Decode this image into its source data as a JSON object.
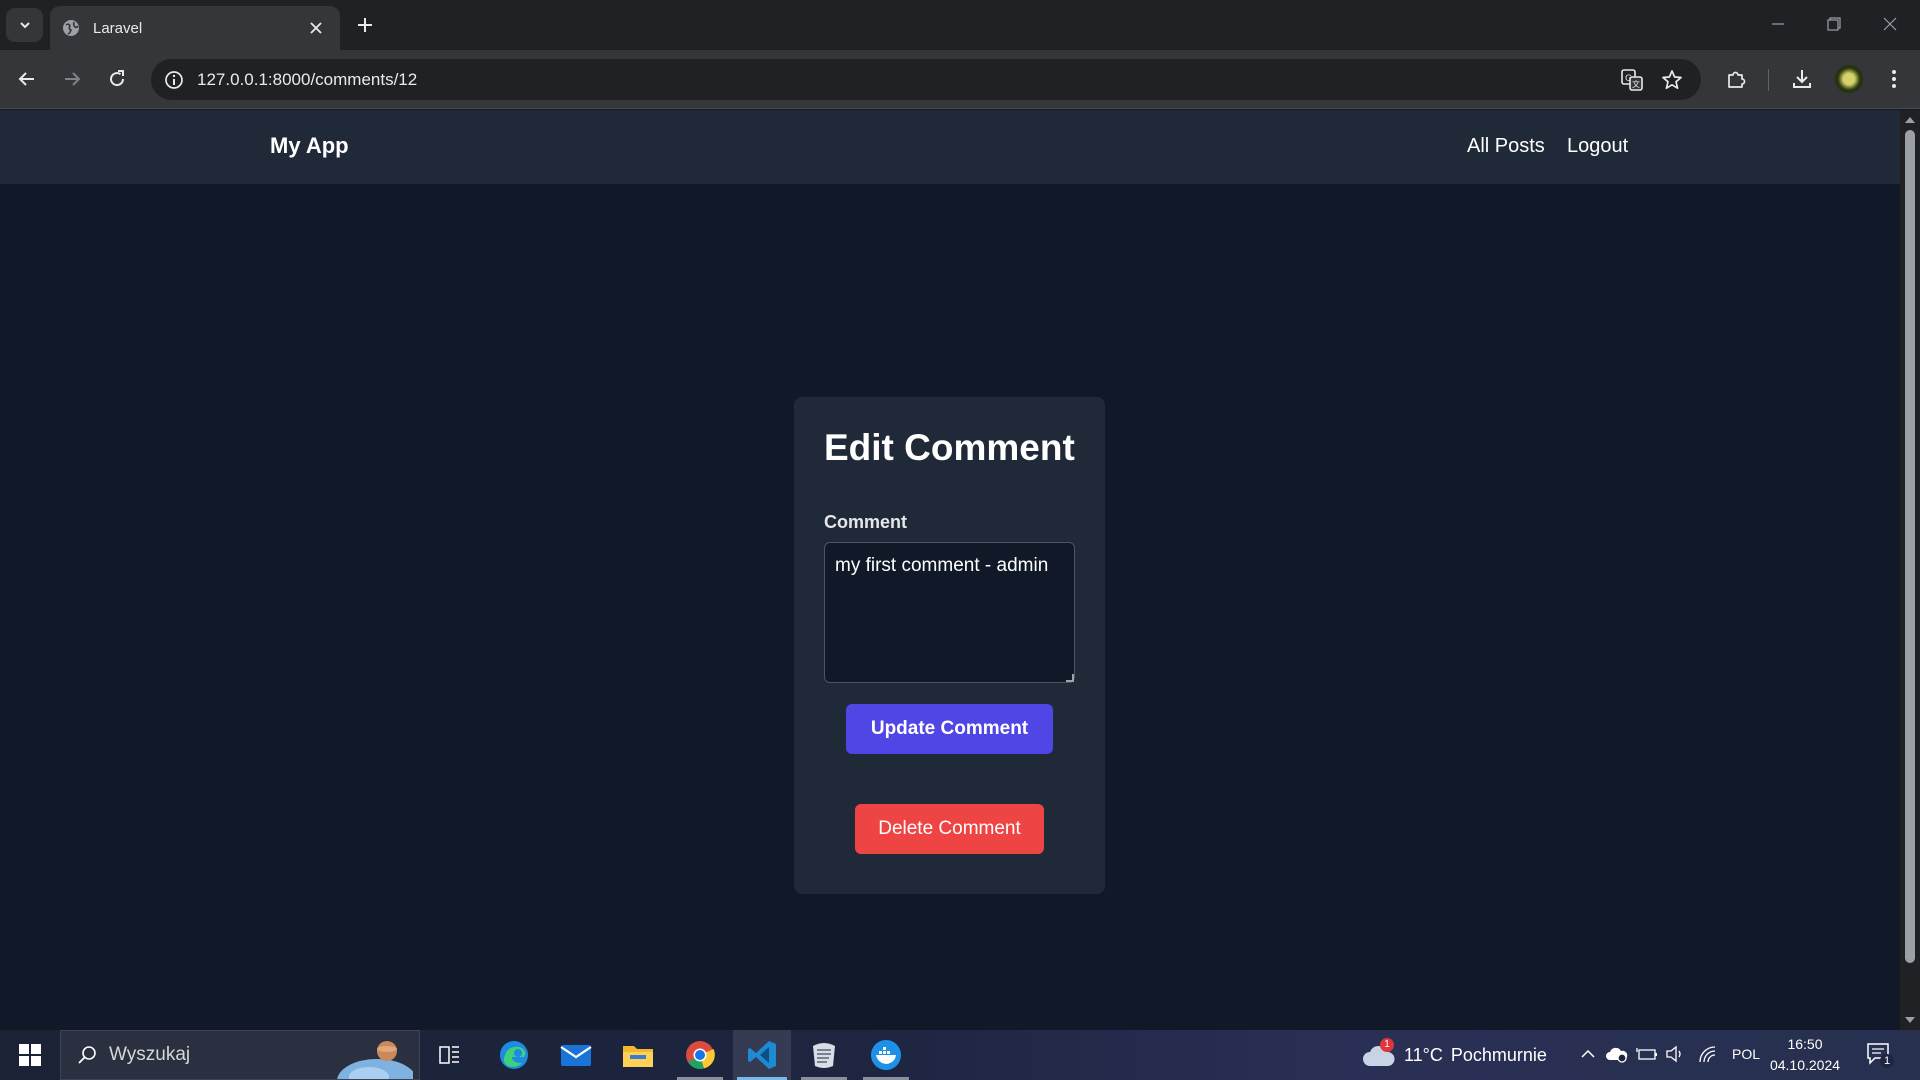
{
  "browser": {
    "tab_title": "Laravel",
    "url": "127.0.0.1:8000/comments/12"
  },
  "app_nav": {
    "brand": "My App",
    "links": [
      "All Posts",
      "Logout"
    ]
  },
  "edit_form": {
    "title": "Edit Comment",
    "field_label": "Comment",
    "comment_value": "my first comment - admin",
    "update_label": "Update Comment",
    "delete_label": "Delete Comment"
  },
  "colors": {
    "page_bg": "#111827",
    "card_bg": "#1f2937",
    "update_button": "#4f46e5",
    "delete_button": "#ef4444"
  },
  "taskbar": {
    "search_placeholder": "Wyszukaj",
    "apps": [
      "task-view-icon",
      "edge-icon",
      "mail-icon",
      "file-explorer-icon",
      "chrome-icon",
      "vscode-icon",
      "wsl-icon",
      "docker-icon"
    ],
    "weather": {
      "temperature": "11°C",
      "condition": "Pochmurnie",
      "alert_count": "1"
    },
    "language": "POL",
    "time": "16:50",
    "date": "04.10.2024",
    "notification_count": "1"
  }
}
